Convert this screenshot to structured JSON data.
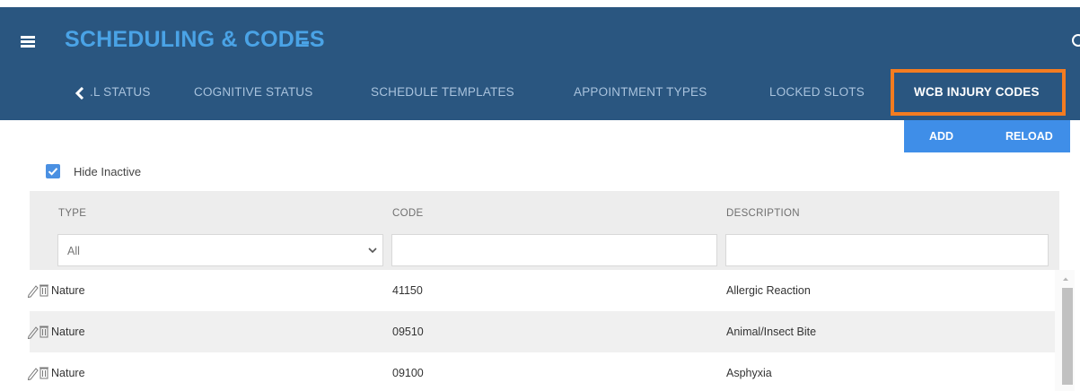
{
  "header": {
    "title": "SCHEDULING & CODES",
    "tabs": [
      {
        "label": ".L STATUS"
      },
      {
        "label": "COGNITIVE STATUS"
      },
      {
        "label": "SCHEDULE TEMPLATES"
      },
      {
        "label": "APPOINTMENT TYPES"
      },
      {
        "label": "LOCKED SLOTS"
      },
      {
        "label": "WCB INJURY CODES"
      }
    ],
    "active_tab": "WCB INJURY CODES",
    "highlight_color": "#f47c20"
  },
  "actions": {
    "add_label": "ADD",
    "reload_label": "RELOAD"
  },
  "filters": {
    "hide_inactive_label": "Hide Inactive",
    "hide_inactive_checked": true,
    "type_select_value": "All"
  },
  "table": {
    "columns": [
      "TYPE",
      "CODE",
      "DESCRIPTION"
    ],
    "rows": [
      {
        "type": "Nature",
        "code": "41150",
        "description": "Allergic Reaction"
      },
      {
        "type": "Nature",
        "code": "09510",
        "description": "Animal/Insect Bite"
      },
      {
        "type": "Nature",
        "code": "09100",
        "description": "Asphyxia"
      }
    ]
  },
  "icons": {
    "menu": "hamburger-icon",
    "back": "chevron-left-icon",
    "refresh": "refresh-icon",
    "edit": "pencil-icon",
    "delete": "trash-icon",
    "dropdown": "chevron-down-icon"
  },
  "colors": {
    "header_bg": "#2a5680",
    "accent": "#3f8ee8",
    "title": "#4aa3e6"
  }
}
